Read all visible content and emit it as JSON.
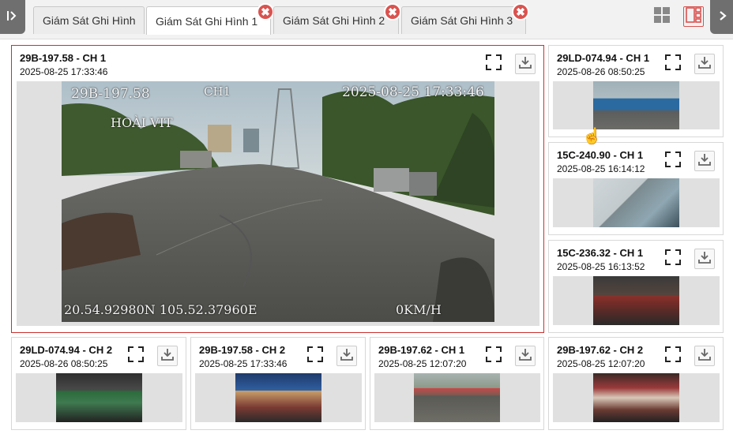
{
  "tabs": [
    {
      "label": "Giám Sát Ghi Hình",
      "active": false,
      "closable": false
    },
    {
      "label": "Giám Sát Ghi Hình 1",
      "active": true,
      "closable": true
    },
    {
      "label": "Giám Sát Ghi Hình 2",
      "active": false,
      "closable": true
    },
    {
      "label": "Giám Sát Ghi Hình 3",
      "active": false,
      "closable": true
    }
  ],
  "icons": {
    "sidebar_toggle": "sidebar-expand-icon",
    "right_arrow": "chevron-right-icon",
    "layout_grid": "grid-layout-icon",
    "layout_focus": "focus-layout-icon",
    "fullscreen": "fullscreen-icon",
    "download": "download-icon",
    "close": "close-icon"
  },
  "main_video": {
    "title": "29B-197.58 - CH 1",
    "time": "2025-08-25 17:33:46",
    "overlay": {
      "plate": "29B-197.58",
      "channel": "CH1",
      "datetime": "2025-08-25 17:33:46",
      "name": "HOÀI VIT",
      "gps": "20.54.92980N 105.52.37960E",
      "speed": "0KM/H"
    }
  },
  "side_videos": [
    {
      "title": "29LD-074.94 - CH 1",
      "time": "2025-08-26 08:50:25",
      "scene": "container"
    },
    {
      "title": "15C-240.90 - CH 1",
      "time": "2025-08-25 16:14:12",
      "scene": "window"
    },
    {
      "title": "15C-236.32 - CH 1",
      "time": "2025-08-25 16:13:52",
      "scene": "cabin-red"
    }
  ],
  "bottom_videos": [
    {
      "title": "29LD-074.94 - CH 2",
      "time": "2025-08-26 08:50:25",
      "scene": "cabin-green"
    },
    {
      "title": "29B-197.58 - CH 2",
      "time": "2025-08-25 17:33:46",
      "scene": "bus-blue"
    },
    {
      "title": "29B-197.62 - CH 1",
      "time": "2025-08-25 12:07:20",
      "scene": "yard"
    },
    {
      "title": "29B-197.62 - CH 2",
      "time": "2025-08-25 12:07:20",
      "scene": "bus-interior"
    }
  ],
  "colors": {
    "accent": "#d9534f",
    "selected_border": "#c9302c",
    "sidebar_button": "#6f6f6f"
  }
}
